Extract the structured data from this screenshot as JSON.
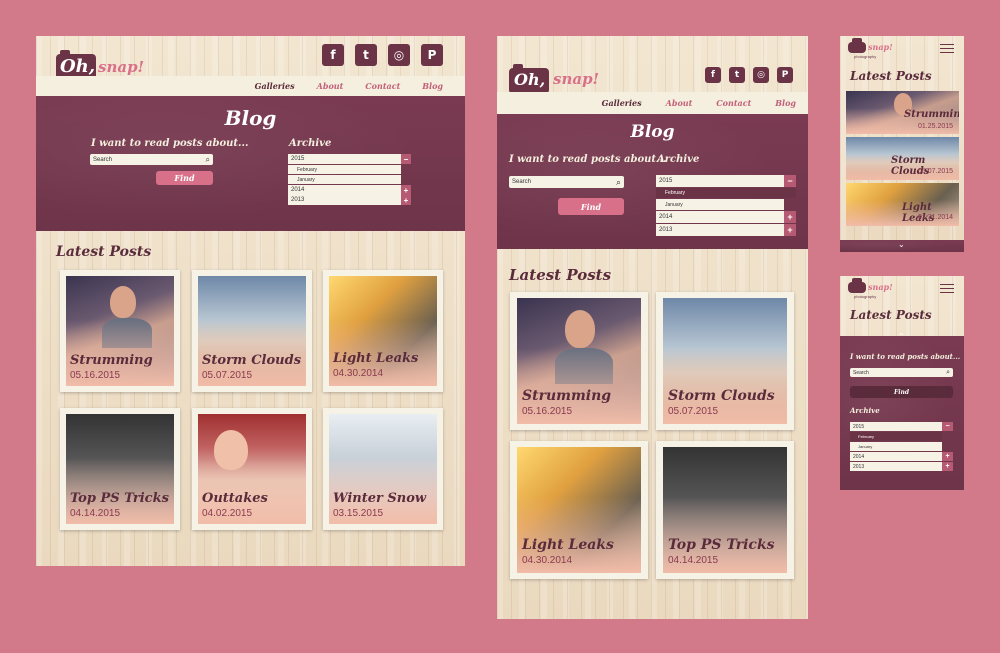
{
  "logo": {
    "oh": "Oh,",
    "snap": "snap!",
    "sub": "photography"
  },
  "social": [
    "f",
    "t",
    "◎",
    "P"
  ],
  "nav": [
    "Galleries",
    "About",
    "Contact",
    "Blog"
  ],
  "hero": {
    "title": "Blog",
    "prompt": "I want to read posts about...",
    "search_placeholder": "Search",
    "find": "Find",
    "archive_label": "Archive",
    "archive_years": [
      "2015",
      "2014",
      "2013"
    ],
    "archive_months": [
      "February",
      "January"
    ],
    "plus": "+",
    "minus": "−"
  },
  "section_title": "Latest Posts",
  "posts": [
    {
      "title": "Strumming",
      "date": "05.16.2015"
    },
    {
      "title": "Storm Clouds",
      "date": "05.07.2015"
    },
    {
      "title": "Light Leaks",
      "date": "04.30.2014"
    },
    {
      "title": "Top PS Tricks",
      "date": "04.14.2015"
    },
    {
      "title": "Outtakes",
      "date": "04.02.2015"
    },
    {
      "title": "Winter Snow",
      "date": "03.15.2015"
    }
  ],
  "mobile_dates": [
    "01.25.2015",
    "05.07.2015",
    "01.31.2014"
  ]
}
